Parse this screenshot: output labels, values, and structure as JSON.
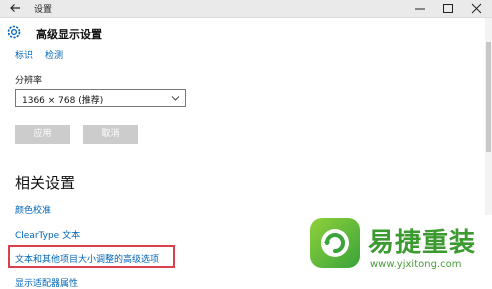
{
  "window": {
    "title": "设置"
  },
  "header": {
    "title": "高级显示设置"
  },
  "top_links": [
    "标识",
    "检测"
  ],
  "resolution": {
    "label": "分辨率",
    "value": "1366 × 768 (推荐)"
  },
  "buttons": {
    "apply": "应用",
    "cancel": "取消"
  },
  "related": {
    "title": "相关设置",
    "links": [
      "颜色校准",
      "ClearType 文本",
      "文本和其他项目大小调整的高级选项",
      "显示适配器属性"
    ]
  },
  "watermark": {
    "title": "易捷重装",
    "url": "www.yjxitong.com"
  },
  "colors": {
    "link": "#0066b8",
    "highlight": "#d9424a",
    "brand": "#3c9b30"
  }
}
